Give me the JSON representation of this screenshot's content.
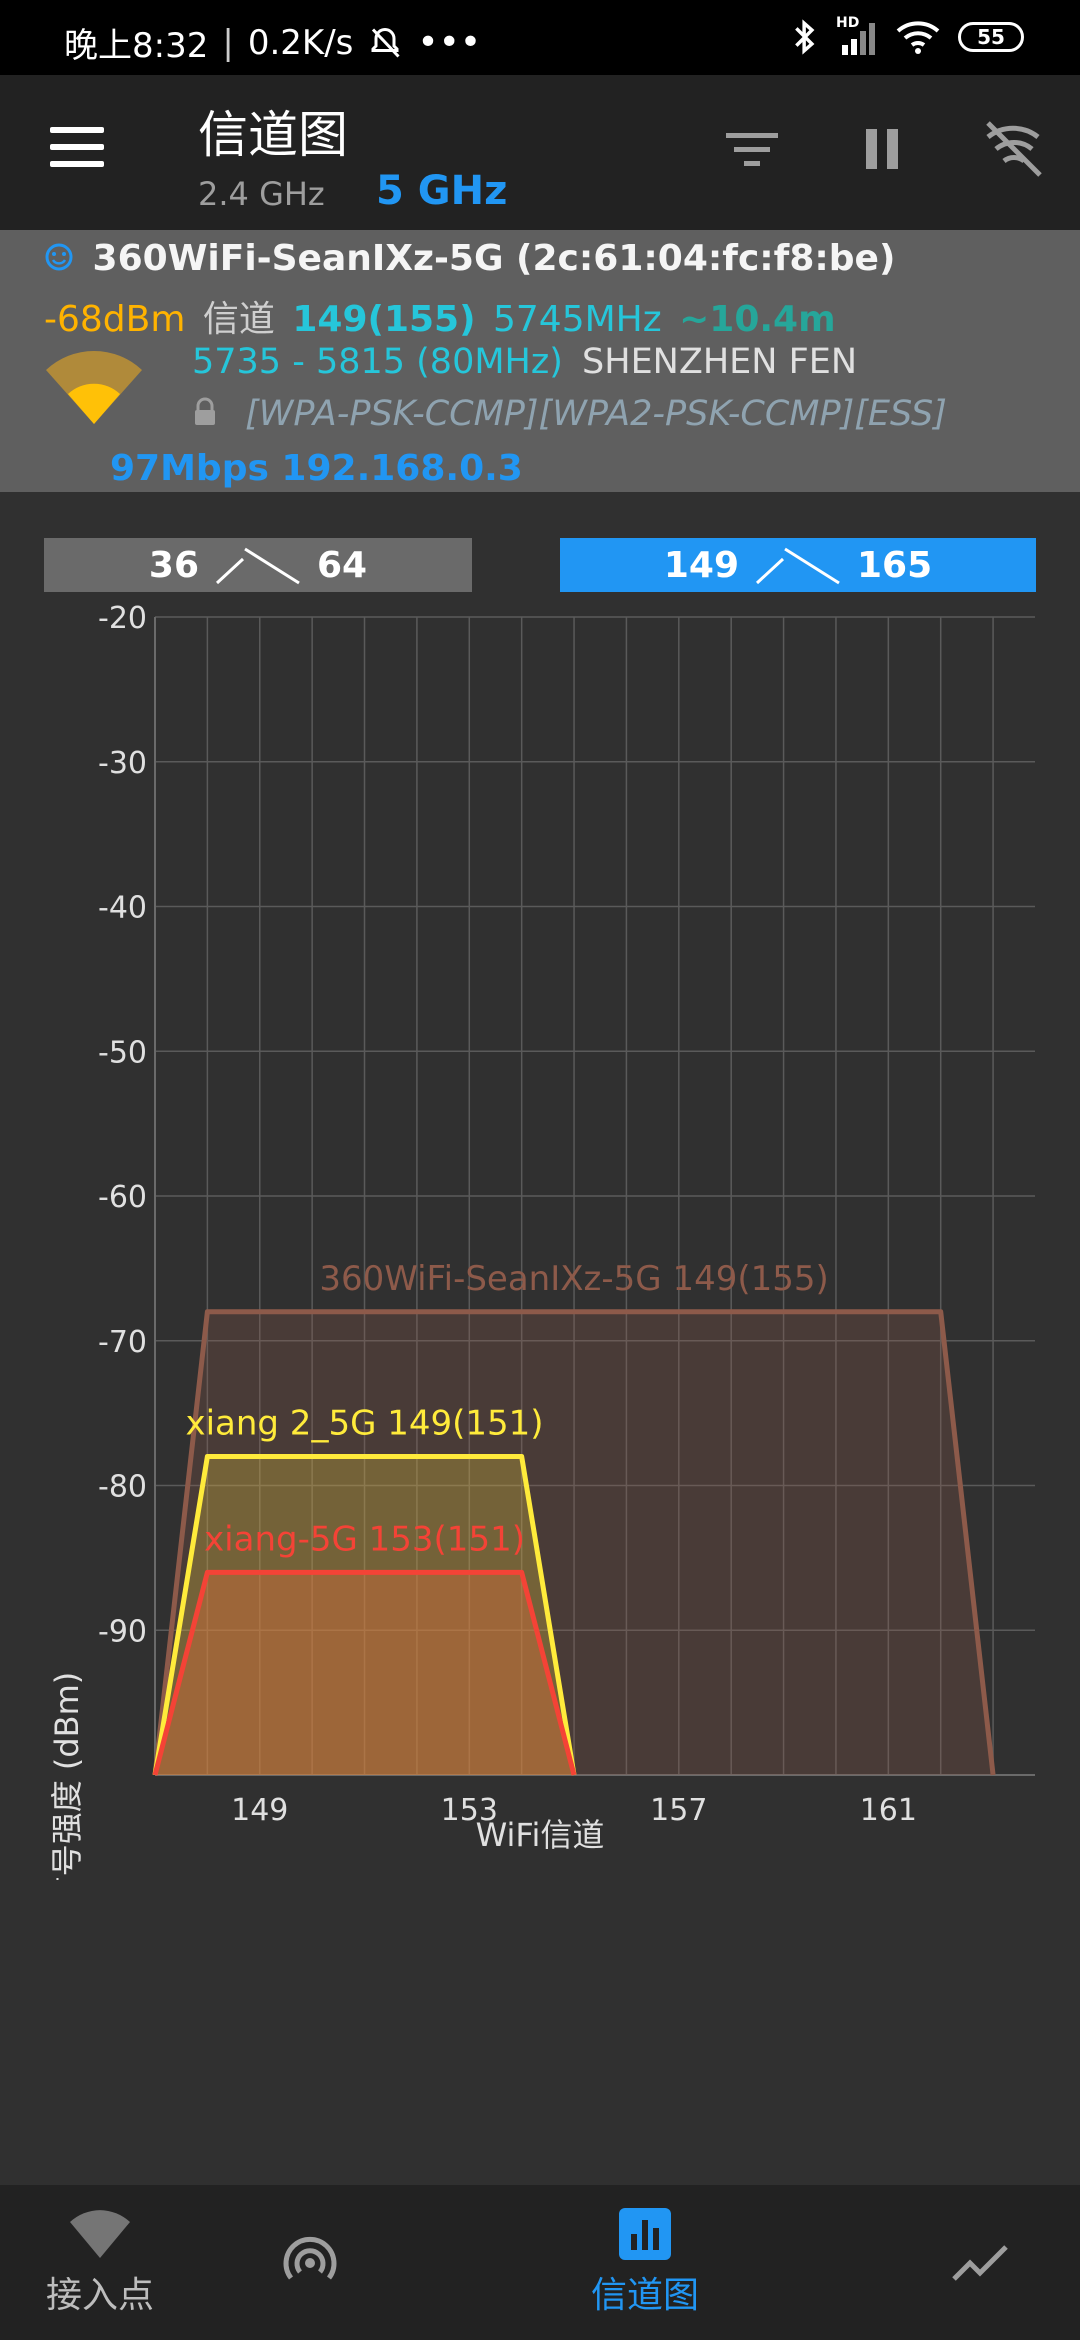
{
  "status_bar": {
    "time": "晚上8:32",
    "speed": "0.2K/s",
    "battery": "55",
    "hd": "HD"
  },
  "app_bar": {
    "title": "信道图",
    "band_24": "2.4 GHz",
    "band_5": "5 GHz"
  },
  "connection": {
    "ssid_mac": "360WiFi-SeanIXz-5G (2c:61:04:fc:f8:be)",
    "signal": "-68dBm",
    "channel_label": "信道",
    "channel": "149(155)",
    "frequency": "5745MHz",
    "distance": "~10.4m",
    "range": "5735 - 5815 (80MHz)",
    "vendor": "SHENZHEN FEN",
    "security": "[WPA-PSK-CCMP][WPA2-PSK-CCMP][ESS]",
    "speed_ip": "97Mbps 192.168.0.3"
  },
  "channel_ranges": [
    {
      "start": "36",
      "end": "64",
      "selected": false
    },
    {
      "start": "149",
      "end": "165",
      "selected": true
    }
  ],
  "colors": {
    "accent": "#2196f3",
    "signal": "#ffb300",
    "channel": "#26c6da",
    "distance": "#26a69a",
    "series_brown": "#8d5a4a",
    "series_yellow": "#ffeb3b",
    "series_red": "#f44336"
  },
  "chart_data": {
    "type": "area",
    "xlabel": "WiFi信道",
    "ylabel": "信号强度 (dBm)",
    "ylim": [
      -100,
      -20
    ],
    "yticks": [
      -20,
      -30,
      -40,
      -50,
      -60,
      -70,
      -80,
      -90
    ],
    "xlim": [
      147,
      163.8
    ],
    "xticks": [
      149,
      153,
      157,
      161
    ],
    "grid": true,
    "series": [
      {
        "name": "360WiFi-SeanIXz-5G 149(155)",
        "color": "#8d5a4a",
        "x": [
          147,
          148,
          162,
          163
        ],
        "y": [
          -100,
          -68,
          -68,
          -100
        ]
      },
      {
        "name": "xiang 2_5G 149(151)",
        "color": "#ffeb3b",
        "x": [
          147,
          148,
          154,
          155
        ],
        "y": [
          -100,
          -78,
          -78,
          -100
        ]
      },
      {
        "name": "xiang-5G 153(151)",
        "color": "#f44336",
        "x": [
          147,
          148,
          154,
          155
        ],
        "y": [
          -100,
          -86,
          -86,
          -100
        ]
      }
    ]
  },
  "bottom_nav": [
    {
      "label": "接入点",
      "icon": "wifi-icon",
      "active": false
    },
    {
      "label": "",
      "icon": "signal-rings-icon",
      "active": false
    },
    {
      "label": "信道图",
      "icon": "bar-chart-icon",
      "active": true
    },
    {
      "label": "",
      "icon": "trend-line-icon",
      "active": false
    }
  ]
}
